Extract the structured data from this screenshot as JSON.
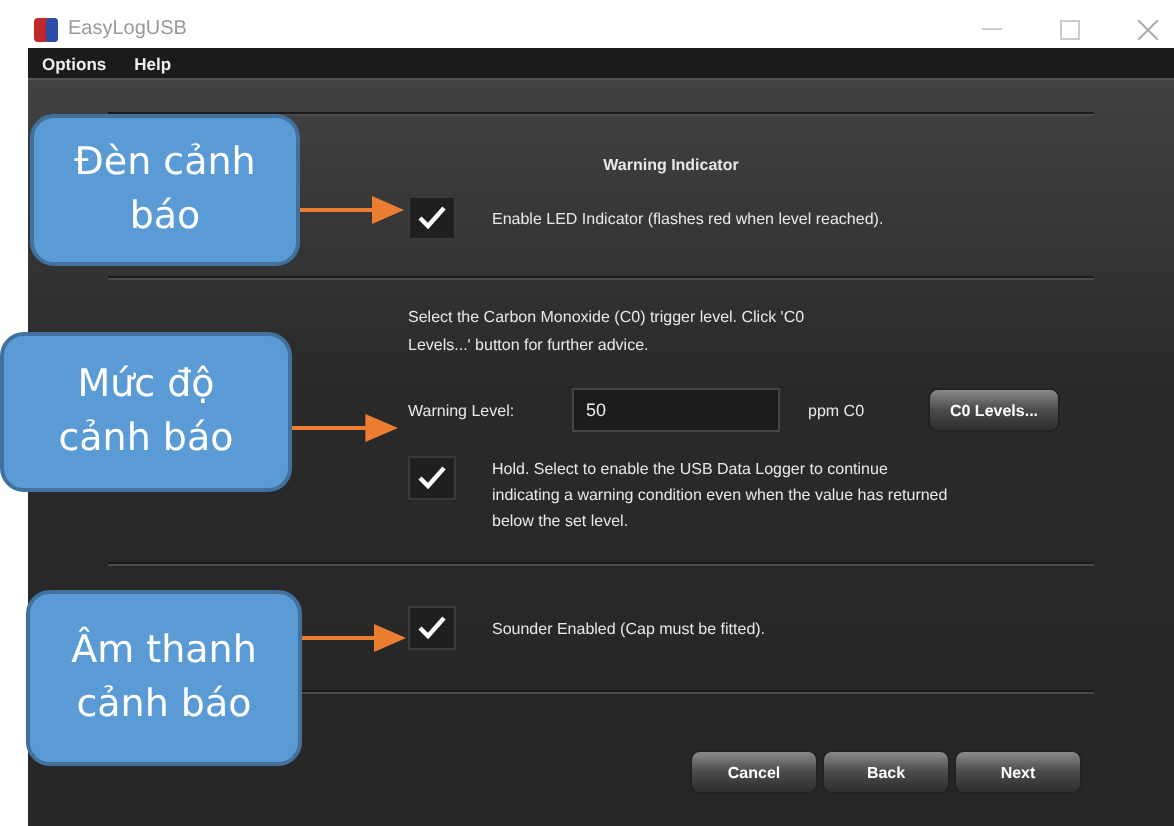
{
  "window": {
    "title": "EasyLogUSB"
  },
  "menu": [
    "Options",
    "Help"
  ],
  "warning_indicator": {
    "title": "Warning Indicator",
    "led": {
      "label": "Enable LED Indicator (flashes red when level reached).",
      "checked": true
    }
  },
  "trigger": {
    "description": "Select the Carbon Monoxide (C0) trigger level. Click 'C0 Levels...' button for further advice.",
    "field_label": "Warning Level:",
    "value": "50",
    "unit": "ppm C0",
    "button": "C0 Levels...",
    "hold": {
      "label": "Hold. Select to enable the USB Data Logger to continue indicating a warning condition even when the value has returned below the set level.",
      "checked": true
    }
  },
  "sounder": {
    "label": "Sounder Enabled (Cap must be fitted).",
    "checked": true
  },
  "buttons": [
    "Cancel",
    "Back",
    "Next"
  ],
  "callouts": [
    {
      "text": "Đèn cảnh báo"
    },
    {
      "text": "Mức độ cảnh báo"
    },
    {
      "text": "Âm thanh cảnh báo"
    }
  ]
}
